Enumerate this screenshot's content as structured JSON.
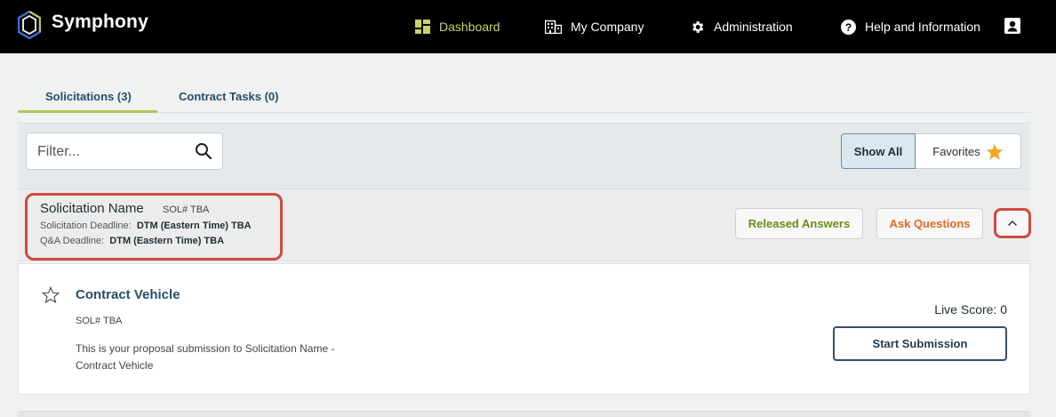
{
  "app": {
    "brand": "Symphony",
    "accent_color": "#c9d36a"
  },
  "nav": {
    "dashboard": "Dashboard",
    "my_company": "My Company",
    "administration": "Administration",
    "help": "Help and Information",
    "icons": [
      "dashboard-icon",
      "building-icon",
      "gear-icon",
      "help-circle-icon",
      "user-icon"
    ]
  },
  "tabs": [
    {
      "label": "Solicitations (3)",
      "active": true
    },
    {
      "label": "Contract Tasks (0)",
      "active": false
    }
  ],
  "filter": {
    "placeholder": "Filter...",
    "show_all": "Show All",
    "favorites": "Favorites"
  },
  "solicitation": {
    "name": "Solicitation Name",
    "number": "SOL# TBA",
    "deadline_label": "Solicitation Deadline:",
    "deadline_value": "DTM (Eastern Time) TBA",
    "qa_label": "Q&A Deadline:",
    "qa_value": "DTM (Eastern Time) TBA",
    "released_answers": "Released Answers",
    "ask_questions": "Ask Questions",
    "highlight_color": "#cf4a3d"
  },
  "card": {
    "title": "Contract Vehicle",
    "number": "SOL# TBA",
    "description": "This is your proposal submission to Solicitation Name - Contract Vehicle",
    "live_score": "Live Score: 0",
    "start_button": "Start Submission"
  }
}
